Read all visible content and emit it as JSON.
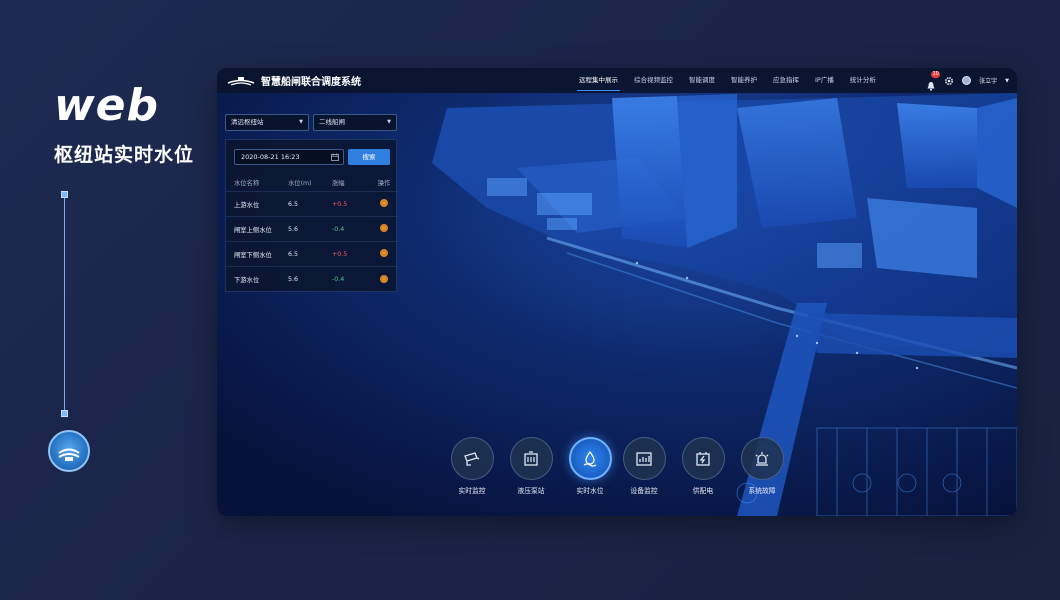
{
  "promo": {
    "title": "web",
    "subtitle": "枢纽站实时水位"
  },
  "app": {
    "title": "智慧船闸联合调度系统",
    "nav": [
      {
        "label": "远程集中展示",
        "active": true
      },
      {
        "label": "综合视频监控",
        "active": false
      },
      {
        "label": "智能调度",
        "active": false
      },
      {
        "label": "智能养护",
        "active": false
      },
      {
        "label": "应急指挥",
        "active": false
      },
      {
        "label": "IP广播",
        "active": false
      },
      {
        "label": "统计分析",
        "active": false
      }
    ],
    "notification_count": "10",
    "user": "张立宇"
  },
  "filters": {
    "station": "清远枢纽站",
    "lock": "二线船闸",
    "datetime": "2020-08-21 16:23",
    "search_label": "搜索"
  },
  "table": {
    "headers": [
      "水位名称",
      "水位(m)",
      "涨幅",
      "操作"
    ],
    "rows": [
      {
        "name": "上游水位",
        "level": "6.5",
        "change": "+0.5",
        "trend": "up"
      },
      {
        "name": "闸室上侧水位",
        "level": "5.6",
        "change": "-0.4",
        "trend": "down"
      },
      {
        "name": "闸室下侧水位",
        "level": "6.5",
        "change": "+0.5",
        "trend": "up"
      },
      {
        "name": "下游水位",
        "level": "5.6",
        "change": "-0.4",
        "trend": "down"
      }
    ]
  },
  "dock": [
    {
      "label": "实时监控",
      "icon": "camera-icon",
      "active": false
    },
    {
      "label": "液压泵站",
      "icon": "pump-icon",
      "active": false
    },
    {
      "label": "实时水位",
      "icon": "water-drop-icon",
      "active": true
    },
    {
      "label": "设备监控",
      "icon": "equipment-icon",
      "active": false
    },
    {
      "label": "供配电",
      "icon": "power-icon",
      "active": false
    },
    {
      "label": "系统故障",
      "icon": "alarm-icon",
      "active": false
    }
  ],
  "colors": {
    "accent": "#2f7fe0",
    "up": "#ff5a5a",
    "down": "#3ecf8e"
  }
}
